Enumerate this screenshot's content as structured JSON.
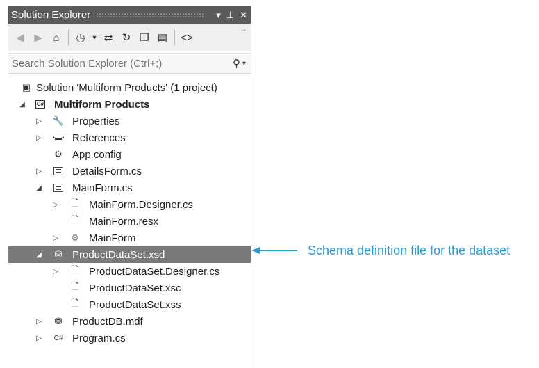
{
  "panel": {
    "title": "Solution Explorer",
    "title_buttons": {
      "dropdown": "▾",
      "pin": "ᵖ",
      "close": "✕"
    },
    "toolbar": {
      "back_icon": "back-icon",
      "forward_icon": "forward-icon",
      "home_icon": "home-icon",
      "history_icon": "history-icon",
      "sync_icon": "sync-icon",
      "refresh_icon": "refresh-icon",
      "collapse_icon": "collapse-all-icon",
      "show_all_icon": "show-all-files-icon",
      "view_code_icon": "view-code-icon"
    },
    "search": {
      "placeholder": "Search Solution Explorer (Ctrl+;)"
    }
  },
  "tree": {
    "items": [
      {
        "label": "Solution 'Multiform Products' (1 project)",
        "icon": "solution-icon",
        "expander": "",
        "bold": false,
        "selected": false
      },
      {
        "label": "Multiform Products",
        "icon": "csharp-project-icon",
        "expander": "expanded",
        "bold": true,
        "selected": false
      },
      {
        "label": "Properties",
        "icon": "wrench-icon",
        "expander": "collapsed",
        "bold": false,
        "selected": false
      },
      {
        "label": "References",
        "icon": "references-icon",
        "expander": "collapsed",
        "bold": false,
        "selected": false
      },
      {
        "label": "App.config",
        "icon": "config-icon",
        "expander": "",
        "bold": false,
        "selected": false
      },
      {
        "label": "DetailsForm.cs",
        "icon": "form-icon",
        "expander": "collapsed",
        "bold": false,
        "selected": false
      },
      {
        "label": "MainForm.cs",
        "icon": "form-icon",
        "expander": "expanded",
        "bold": false,
        "selected": false
      },
      {
        "label": "MainForm.Designer.cs",
        "icon": "file-icon",
        "expander": "collapsed",
        "bold": false,
        "selected": false
      },
      {
        "label": "MainForm.resx",
        "icon": "file-icon",
        "expander": "",
        "bold": false,
        "selected": false
      },
      {
        "label": "MainForm",
        "icon": "class-icon",
        "expander": "collapsed",
        "bold": false,
        "selected": false
      },
      {
        "label": "ProductDataSet.xsd",
        "icon": "dataset-icon",
        "expander": "expanded",
        "bold": false,
        "selected": true
      },
      {
        "label": "ProductDataSet.Designer.cs",
        "icon": "file-icon",
        "expander": "collapsed",
        "bold": false,
        "selected": false
      },
      {
        "label": "ProductDataSet.xsc",
        "icon": "file-icon",
        "expander": "",
        "bold": false,
        "selected": false
      },
      {
        "label": "ProductDataSet.xss",
        "icon": "file-icon",
        "expander": "",
        "bold": false,
        "selected": false
      },
      {
        "label": "ProductDB.mdf",
        "icon": "database-icon",
        "expander": "collapsed",
        "bold": false,
        "selected": false
      },
      {
        "label": "Program.cs",
        "icon": "csharp-file-icon",
        "expander": "collapsed",
        "bold": false,
        "selected": false
      }
    ]
  },
  "callout": {
    "text": "Schema definition file for the dataset",
    "color": "#2a9bd6"
  }
}
